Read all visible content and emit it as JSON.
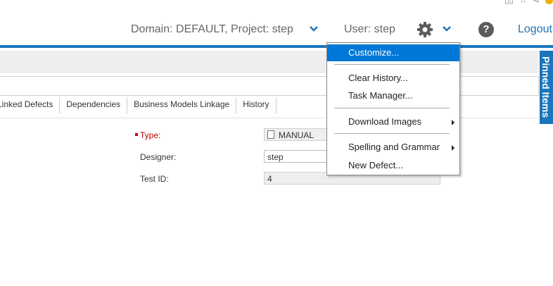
{
  "header": {
    "domain_project": "Domain: DEFAULT, Project: step",
    "user": "User: step",
    "logout": "Logout",
    "help": "?"
  },
  "tabs": [
    "Linked Defects",
    "Dependencies",
    "Business Models Linkage",
    "History"
  ],
  "pinned_items": "Pinned Items",
  "form": {
    "type_label": "Type:",
    "type_value": "MANUAL",
    "designer_label": "Designer:",
    "designer_value": "step",
    "testid_label": "Test ID:",
    "testid_value": "4"
  },
  "menu": {
    "items": [
      "Customize...",
      "Clear History...",
      "Task Manager...",
      "Download Images",
      "Spelling and Grammar",
      "New Defect..."
    ]
  },
  "colors": {
    "accent": "#1b75bb",
    "menu_highlight": "#0078d7",
    "required": "#c00000"
  }
}
